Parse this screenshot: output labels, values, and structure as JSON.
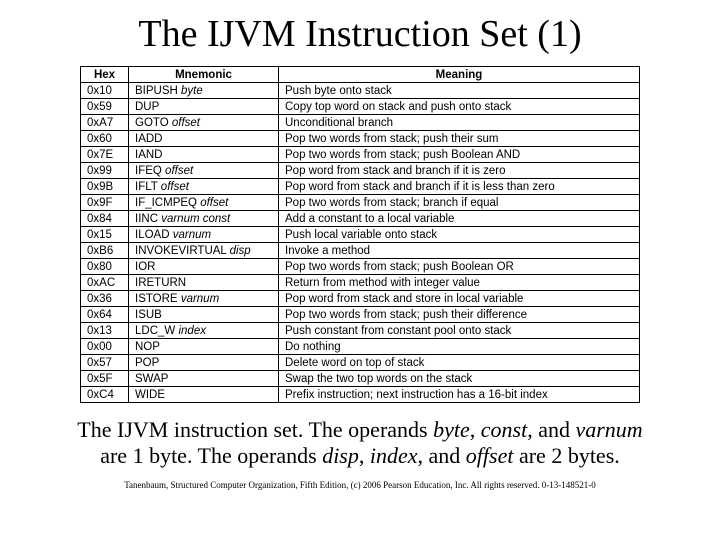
{
  "title": "The IJVM Instruction Set (1)",
  "headers": {
    "hex": "Hex",
    "mnemonic": "Mnemonic",
    "meaning": "Meaning"
  },
  "rows": [
    {
      "hex": "0x10",
      "mnem": "BIPUSH",
      "arg": "byte",
      "meaning": "Push byte onto stack"
    },
    {
      "hex": "0x59",
      "mnem": "DUP",
      "arg": "",
      "meaning": "Copy top word on stack and push onto stack"
    },
    {
      "hex": "0xA7",
      "mnem": "GOTO",
      "arg": "offset",
      "meaning": "Unconditional branch"
    },
    {
      "hex": "0x60",
      "mnem": "IADD",
      "arg": "",
      "meaning": "Pop two words from stack; push their sum"
    },
    {
      "hex": "0x7E",
      "mnem": "IAND",
      "arg": "",
      "meaning": "Pop two words from stack; push Boolean AND"
    },
    {
      "hex": "0x99",
      "mnem": "IFEQ",
      "arg": "offset",
      "meaning": "Pop word from stack and branch if it is zero"
    },
    {
      "hex": "0x9B",
      "mnem": "IFLT",
      "arg": "offset",
      "meaning": "Pop word from stack and branch if it is less than zero"
    },
    {
      "hex": "0x9F",
      "mnem": "IF_ICMPEQ",
      "arg": "offset",
      "meaning": "Pop two words from stack; branch if equal"
    },
    {
      "hex": "0x84",
      "mnem": "IINC",
      "arg": "varnum const",
      "meaning": "Add a constant to a local variable"
    },
    {
      "hex": "0x15",
      "mnem": "ILOAD",
      "arg": "varnum",
      "meaning": "Push local variable onto stack"
    },
    {
      "hex": "0xB6",
      "mnem": "INVOKEVIRTUAL",
      "arg": "disp",
      "meaning": "Invoke a method"
    },
    {
      "hex": "0x80",
      "mnem": "IOR",
      "arg": "",
      "meaning": "Pop two words from stack; push Boolean OR"
    },
    {
      "hex": "0xAC",
      "mnem": "IRETURN",
      "arg": "",
      "meaning": "Return from method with integer value"
    },
    {
      "hex": "0x36",
      "mnem": "ISTORE",
      "arg": "varnum",
      "meaning": "Pop word from stack and store in local variable"
    },
    {
      "hex": "0x64",
      "mnem": "ISUB",
      "arg": "",
      "meaning": "Pop two words from stack; push their difference"
    },
    {
      "hex": "0x13",
      "mnem": "LDC_W",
      "arg": "index",
      "meaning": "Push constant from constant pool onto stack"
    },
    {
      "hex": "0x00",
      "mnem": "NOP",
      "arg": "",
      "meaning": "Do nothing"
    },
    {
      "hex": "0x57",
      "mnem": "POP",
      "arg": "",
      "meaning": "Delete word on top of stack"
    },
    {
      "hex": "0x5F",
      "mnem": "SWAP",
      "arg": "",
      "meaning": "Swap the two top words on the stack"
    },
    {
      "hex": "0xC4",
      "mnem": "WIDE",
      "arg": "",
      "meaning": "Prefix instruction; next instruction has a 16-bit index"
    }
  ],
  "caption": {
    "t1": "The IJVM instruction set. The operands ",
    "i1": "byte",
    "c1": ", ",
    "i2": "const",
    "c2": ", and ",
    "i3": "varnum",
    "t2": " are 1 byte. The operands ",
    "i4": "disp",
    "c3": ", ",
    "i5": "index",
    "c4": ", and ",
    "i6": "offset",
    "t3": " are 2 bytes."
  },
  "footer": "Tanenbaum, Structured Computer Organization, Fifth Edition, (c) 2006 Pearson Education, Inc. All rights reserved. 0-13-148521-0"
}
